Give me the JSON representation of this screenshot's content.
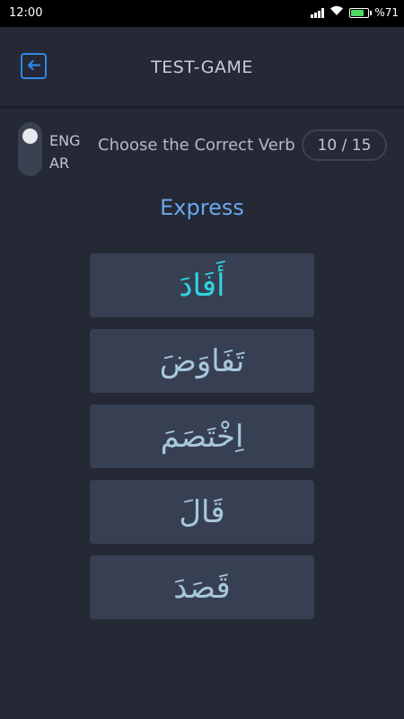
{
  "status_bar": {
    "time": "12:00",
    "battery_text": "%71",
    "battery_level": 0.71,
    "icons": [
      "signal-icon",
      "wifi-icon",
      "battery-charging-icon"
    ]
  },
  "header": {
    "title": "TEST-GAME",
    "back_icon": "arrow-left-icon"
  },
  "language_toggle": {
    "eng_label": "ENG",
    "ar_label": "AR",
    "selected": "ENG"
  },
  "question": {
    "instruction": "Choose the Correct Verb",
    "counter": "10 / 15",
    "word": "Express"
  },
  "options": [
    {
      "text": "أَفَادَ",
      "highlighted": true
    },
    {
      "text": "تَفَاوَضَ",
      "highlighted": false
    },
    {
      "text": "اِخْتَصَمَ",
      "highlighted": false
    },
    {
      "text": "قَالَ",
      "highlighted": false
    },
    {
      "text": "قَصَدَ",
      "highlighted": false
    }
  ],
  "colors": {
    "background": "#242935",
    "accent_blue": "#2f86e8",
    "word_blue": "#6ba6ec",
    "option_bg": "#374052",
    "highlight_cyan": "#2ed5e0",
    "option_text": "#a7c7dc"
  }
}
